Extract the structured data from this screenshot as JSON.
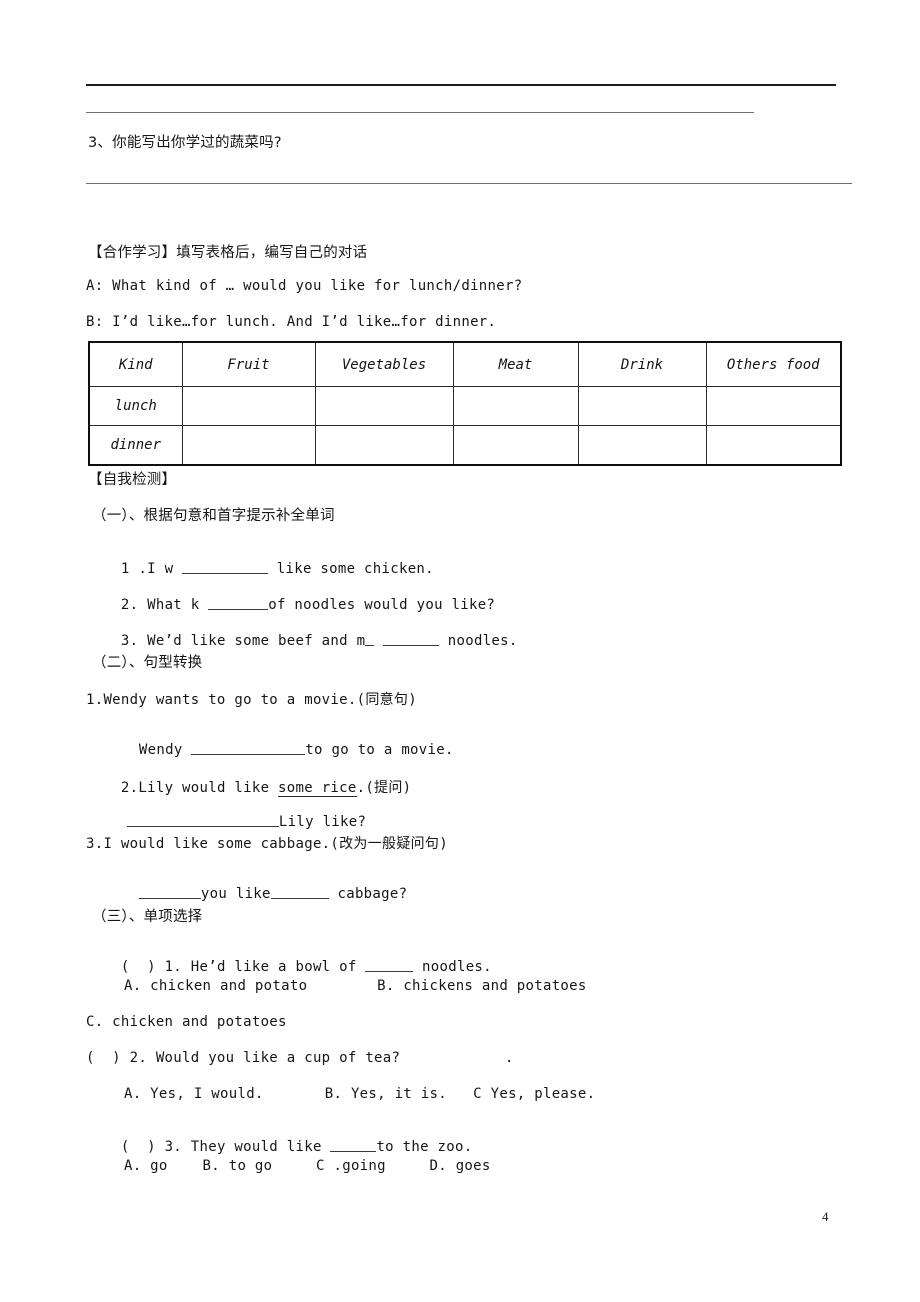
{
  "page": {
    "number": "4",
    "background": "#ffffff",
    "ink": "#161616"
  },
  "rules": {
    "top_heavy": "",
    "top_light": "",
    "after_q3": ""
  },
  "questions_top": {
    "q3": "3、你能写出你学过的蔬菜吗?"
  },
  "cooperative": {
    "heading": "【合作学习】填写表格后，编写自己的对话",
    "line_a": "A: What kind of … would you like for lunch/dinner?",
    "line_b": "B: I’d like…for lunch. And I’d like…for dinner."
  },
  "table": {
    "headers": [
      "Kind",
      "Fruit",
      "Vegetables",
      "Meat",
      "Drink",
      "Others food"
    ],
    "rows": [
      {
        "label": "lunch",
        "cells": [
          "",
          "",
          "",
          "",
          ""
        ]
      },
      {
        "label": "dinner",
        "cells": [
          "",
          "",
          "",
          "",
          ""
        ]
      }
    ]
  },
  "self_test": {
    "heading": "【自我检测】",
    "section_one": {
      "title": "（一）、根据句意和首字提示补全单词",
      "items": [
        {
          "pre": "1 .I w ",
          "post": " like some chicken."
        },
        {
          "pre": "2. What k ",
          "post": "of noodles would you like?"
        },
        {
          "pre": "3. We’d like some beef and m",
          "post": " noodles."
        }
      ]
    },
    "section_two": {
      "title": "（二）、句型转换",
      "items": [
        {
          "prompt": "1.Wendy wants to go to a movie.(同意句)",
          "answer_pre": "Wendy ",
          "answer_post": "to go to a movie."
        },
        {
          "prompt_pre": "2.Lily would like ",
          "prompt_underlined": "some rice",
          "prompt_post": ".(提问)",
          "answer_pre": "",
          "answer_post": "Lily like?"
        },
        {
          "prompt": "3.I would like some cabbage.(改为一般疑问句)",
          "answer_pre": "",
          "answer_mid": "you like",
          "answer_post": " cabbage?"
        }
      ]
    },
    "section_three": {
      "title": "（三）、单项选择",
      "items": [
        {
          "stem_pre": "(  ) 1. He’d like a bowl of ",
          "stem_post": " noodles.",
          "options_line1": "A. chicken and potato        B. chickens and potatoes",
          "options_line2": "C. chicken and potatoes"
        },
        {
          "stem": "(  ) 2. Would you like a cup of tea?            .",
          "options_line1": "A. Yes, I would.       B. Yes, it is.   C Yes, please.",
          "options_line2": ""
        },
        {
          "stem_pre": "(  ) 3. They would like ",
          "stem_post": "to the zoo.",
          "options_line1": "A. go    B. to go     C .going     D. goes",
          "options_line2": ""
        }
      ]
    }
  }
}
